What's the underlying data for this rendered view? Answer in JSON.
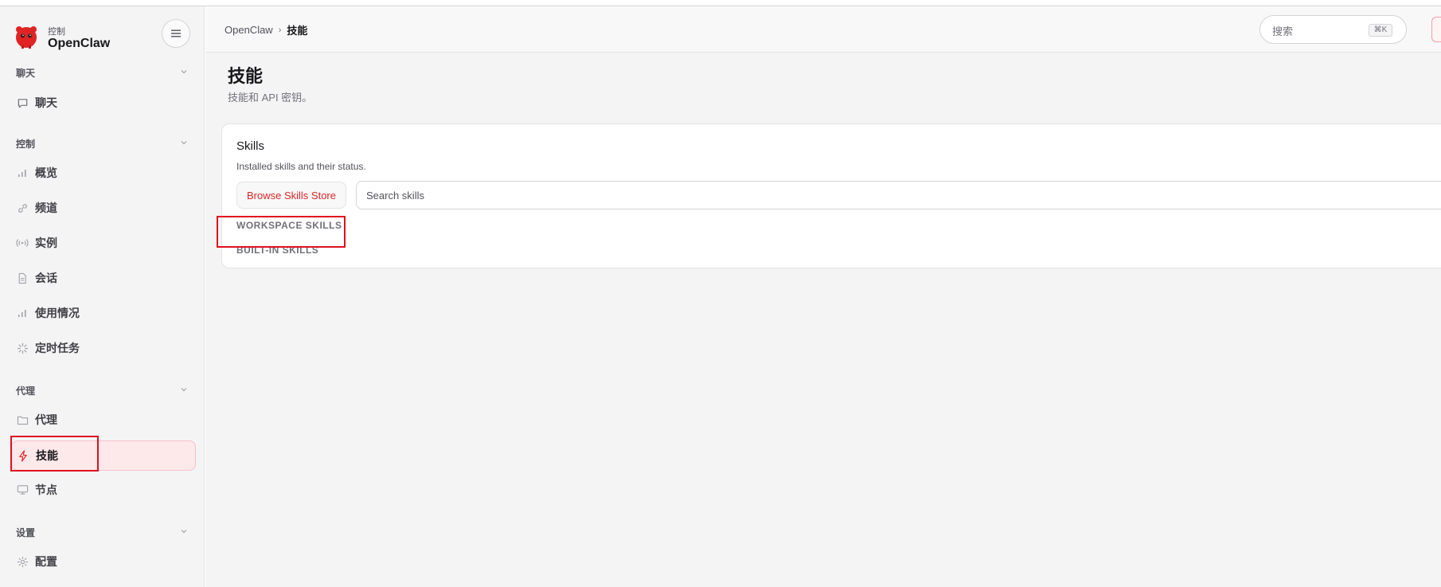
{
  "brand": {
    "subtitle": "控制",
    "title": "OpenClaw"
  },
  "sidebar": {
    "groups": [
      {
        "label": "聊天",
        "items": [
          {
            "label": "聊天",
            "icon": "chat-bubble-icon"
          }
        ]
      },
      {
        "label": "控制",
        "items": [
          {
            "label": "概览",
            "icon": "bar-chart-icon"
          },
          {
            "label": "频道",
            "icon": "link-icon"
          },
          {
            "label": "实例",
            "icon": "broadcast-icon"
          },
          {
            "label": "会话",
            "icon": "document-icon"
          },
          {
            "label": "使用情况",
            "icon": "bar-chart-icon"
          },
          {
            "label": "定时任务",
            "icon": "loader-icon"
          }
        ]
      },
      {
        "label": "代理",
        "items": [
          {
            "label": "代理",
            "icon": "folder-icon"
          },
          {
            "label": "技能",
            "icon": "lightning-icon",
            "active": true
          },
          {
            "label": "节点",
            "icon": "monitor-icon"
          }
        ]
      },
      {
        "label": "设置",
        "items": [
          {
            "label": "配置",
            "icon": "gear-icon"
          }
        ]
      }
    ]
  },
  "header": {
    "breadcrumb": [
      "OpenClaw",
      "技能"
    ],
    "breadcrumb_separator": "›",
    "search_placeholder": "搜索",
    "search_shortcut": "⌘K"
  },
  "page": {
    "title": "技能",
    "subtitle": "技能和 API 密钥。"
  },
  "skills_card": {
    "title": "Skills",
    "subtitle": "Installed skills and their status.",
    "store_button": "Browse Skills Store",
    "search_placeholder": "Search skills",
    "sections": [
      "WORKSPACE SKILLS",
      "BUILT-IN SKILLS"
    ]
  },
  "colors": {
    "accent": "#dc2626",
    "active_bg": "#fde8ea",
    "annotation": "#e0101e"
  }
}
